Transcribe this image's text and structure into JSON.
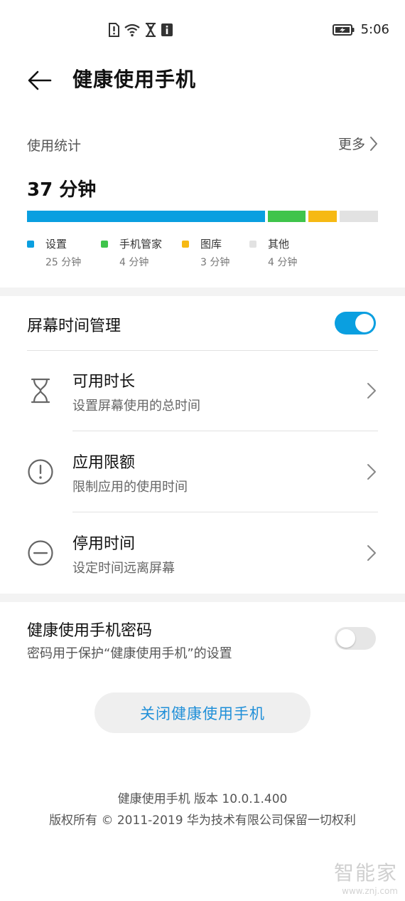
{
  "status_bar": {
    "time": "5:06",
    "icons": [
      "sim-alert-icon",
      "wifi-icon",
      "hourglass-icon",
      "info-icon",
      "battery-charging-icon"
    ]
  },
  "header": {
    "title": "健康使用手机"
  },
  "usage": {
    "label": "使用统计",
    "more_label": "更多",
    "total": "37 分钟",
    "segments": [
      {
        "name": "设置",
        "time": "25 分钟",
        "minutes": 25,
        "color": "#0a9fe0"
      },
      {
        "name": "手机管家",
        "time": "4 分钟",
        "minutes": 4,
        "color": "#3fc44b"
      },
      {
        "name": "图库",
        "time": "3 分钟",
        "minutes": 3,
        "color": "#f6b914"
      },
      {
        "name": "其他",
        "time": "4 分钟",
        "minutes": 4,
        "color": "#e2e2e2"
      }
    ]
  },
  "screen_time": {
    "label": "屏幕时间管理",
    "enabled": true,
    "rows": [
      {
        "title": "可用时长",
        "subtitle": "设置屏幕使用的总时间",
        "icon": "hourglass-icon"
      },
      {
        "title": "应用限额",
        "subtitle": "限制应用的使用时间",
        "icon": "exclamation-circle-icon"
      },
      {
        "title": "停用时间",
        "subtitle": "设定时间远离屏幕",
        "icon": "minus-circle-icon"
      }
    ]
  },
  "password": {
    "title": "健康使用手机密码",
    "subtitle": "密码用于保护“健康使用手机”的设置",
    "enabled": false
  },
  "close_button": "关闭健康使用手机",
  "footer": {
    "version": "健康使用手机 版本 10.0.1.400",
    "copyright": "版权所有 © 2011-2019 华为技术有限公司保留一切权利"
  },
  "watermark": {
    "title": "智能家",
    "url": "www.znj.com"
  },
  "colors": {
    "accent": "#0a9fe0",
    "toggle_off": "#e6e6e6",
    "divider_band": "#f3f3f3"
  }
}
